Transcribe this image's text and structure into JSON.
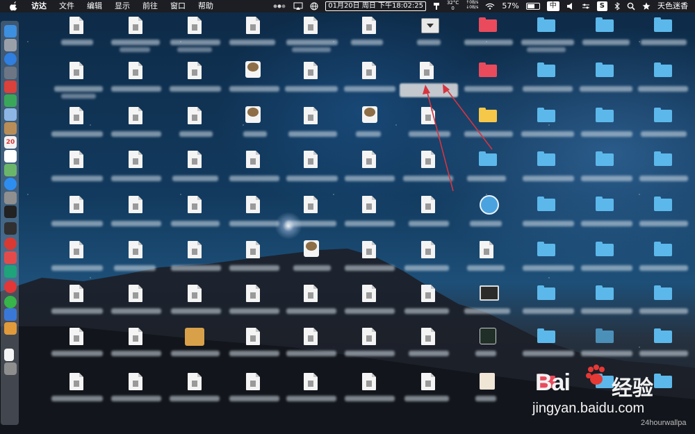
{
  "menubar": {
    "app": "访达",
    "menus": [
      "文件",
      "编辑",
      "显示",
      "前往",
      "窗口",
      "帮助"
    ],
    "status": {
      "date_time": "01月20日 周日 下午18:02:25",
      "temp": "32°C",
      "temp_sub": "0",
      "net_up": "↑0B/s",
      "net_down": "↓0B/s",
      "battery": "57%",
      "input_method": "中",
      "user": "天色迷香"
    }
  },
  "dock": {
    "icons": [
      "finder-icon",
      "launchpad-icon",
      "safari-icon",
      "rocket-icon",
      "badge-app-icon",
      "android-icon",
      "preview-icon",
      "notes-app-icon",
      "calendar-icon",
      "reminders-icon",
      "maps-icon",
      "app-store-icon",
      "system-preferences-icon",
      "activity-monitor-icon",
      "terminal-icon",
      "vivaldi-icon",
      "netease-music-icon",
      "ucloud-icon",
      "yandex-icon",
      "wechat-icon",
      "loop-icon",
      "color-app-icon",
      "document-icon",
      "trash-icon"
    ],
    "calendar_day": "20"
  },
  "desktop": {
    "annotation_color": "#d8343f",
    "watermark": {
      "bai": "Bai",
      "jingyan": "经验",
      "url": "jingyan.baidu.com",
      "credit": "24hourwallpa"
    }
  }
}
